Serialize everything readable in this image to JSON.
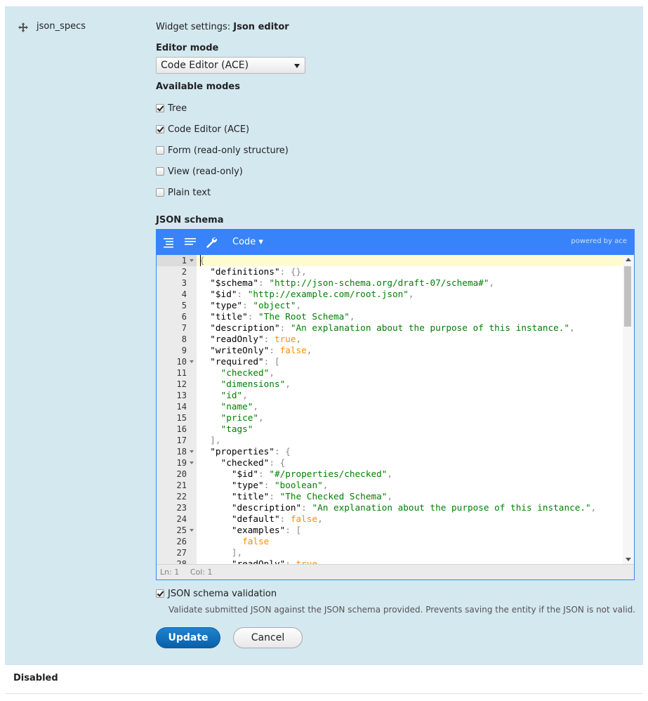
{
  "row": {
    "field_name": "json_specs",
    "drag_icon": "move-cross-icon"
  },
  "settings": {
    "widget_settings_prefix": "Widget settings:",
    "widget_settings_name": "Json editor",
    "editor_mode_label": "Editor mode",
    "editor_mode_value": "Code Editor (ACE)",
    "available_modes_label": "Available modes",
    "modes": [
      {
        "label": "Tree",
        "checked": true
      },
      {
        "label": "Code Editor (ACE)",
        "checked": true
      },
      {
        "label": "Form (read-only structure)",
        "checked": false
      },
      {
        "label": "View (read-only)",
        "checked": false
      },
      {
        "label": "Plain text",
        "checked": false
      }
    ],
    "json_schema_label": "JSON schema",
    "validation_label": "JSON schema validation",
    "validation_checked": true,
    "validation_description": "Validate submitted JSON against the JSON schema provided. Prevents saving the entity if the JSON is not valid.",
    "update_button": "Update",
    "cancel_button": "Cancel"
  },
  "editor": {
    "toolbar_icons": [
      "format-icon",
      "compact-icon",
      "wrench-icon"
    ],
    "mode_menu": "Code ▾",
    "powered_by": "powered by ace",
    "status_ln": "Ln: 1",
    "status_col": "Col: 1",
    "lines": [
      {
        "n": "1",
        "fold": true,
        "text": "{"
      },
      {
        "n": "2",
        "text": "  \"definitions\": {},"
      },
      {
        "n": "3",
        "text": "  \"$schema\": \"http://json-schema.org/draft-07/schema#\","
      },
      {
        "n": "4",
        "text": "  \"$id\": \"http://example.com/root.json\","
      },
      {
        "n": "5",
        "text": "  \"type\": \"object\","
      },
      {
        "n": "6",
        "text": "  \"title\": \"The Root Schema\","
      },
      {
        "n": "7",
        "text": "  \"description\": \"An explanation about the purpose of this instance.\","
      },
      {
        "n": "8",
        "text": "  \"readOnly\": true,"
      },
      {
        "n": "9",
        "text": "  \"writeOnly\": false,"
      },
      {
        "n": "10",
        "fold": true,
        "text": "  \"required\": ["
      },
      {
        "n": "11",
        "text": "    \"checked\","
      },
      {
        "n": "12",
        "text": "    \"dimensions\","
      },
      {
        "n": "13",
        "text": "    \"id\","
      },
      {
        "n": "14",
        "text": "    \"name\","
      },
      {
        "n": "15",
        "text": "    \"price\","
      },
      {
        "n": "16",
        "text": "    \"tags\""
      },
      {
        "n": "17",
        "text": "  ],"
      },
      {
        "n": "18",
        "fold": true,
        "text": "  \"properties\": {"
      },
      {
        "n": "19",
        "fold": true,
        "text": "    \"checked\": {"
      },
      {
        "n": "20",
        "text": "      \"$id\": \"#/properties/checked\","
      },
      {
        "n": "21",
        "text": "      \"type\": \"boolean\","
      },
      {
        "n": "22",
        "text": "      \"title\": \"The Checked Schema\","
      },
      {
        "n": "23",
        "text": "      \"description\": \"An explanation about the purpose of this instance.\","
      },
      {
        "n": "24",
        "text": "      \"default\": false,"
      },
      {
        "n": "25",
        "fold": true,
        "text": "      \"examples\": ["
      },
      {
        "n": "26",
        "text": "        false"
      },
      {
        "n": "27",
        "text": "      ],"
      },
      {
        "n": "28",
        "text": "      \"readOnly\": true,"
      }
    ]
  },
  "footer": {
    "disabled_label": "Disabled"
  }
}
